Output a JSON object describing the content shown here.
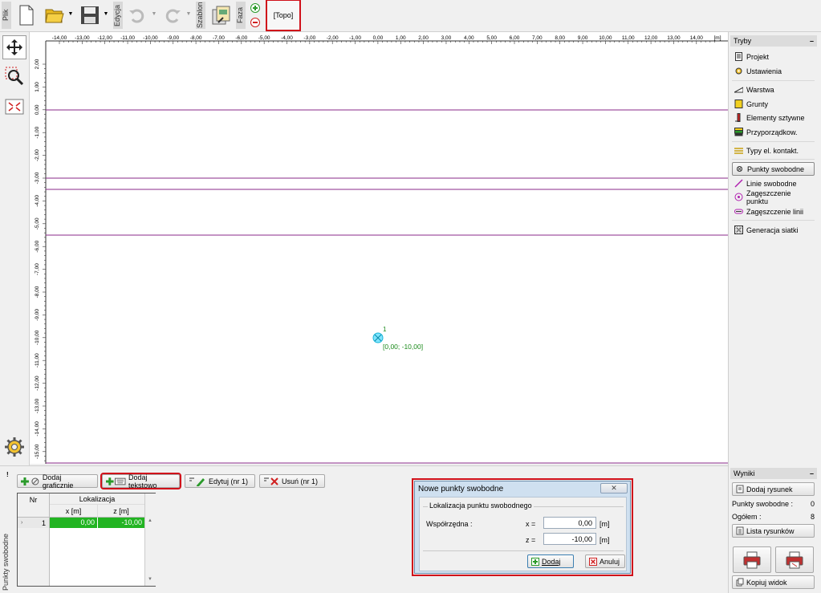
{
  "toolbar": {
    "plik": "Plik",
    "edycja": "Edycja",
    "szablon": "Szablon",
    "faza": "Faza",
    "stage": "[Topo]"
  },
  "ruler_x": {
    "ticks": [
      "-14,00",
      "-13,00",
      "-12,00",
      "-11,00",
      "-10,00",
      "-9,00",
      "-8,00",
      "-7,00",
      "-6,00",
      "-5,00",
      "-4,00",
      "-3,00",
      "-2,00",
      "-1,00",
      "0,00",
      "1,00",
      "2,00",
      "3,00",
      "4,00",
      "5,00",
      "6,00",
      "7,00",
      "8,00",
      "9,00",
      "10,00",
      "11,00",
      "12,00",
      "13,00",
      "14,00"
    ],
    "unit": "[m]"
  },
  "ruler_y": {
    "ticks": [
      "2,00",
      "1,00",
      "0,00",
      "-1,00",
      "-2,00",
      "-3,00",
      "-4,00",
      "-5,00",
      "-6,00",
      "-7,00",
      "-8,00",
      "-9,00",
      "-10,00",
      "-11,00",
      "-12,00",
      "-13,00",
      "-14,00",
      "-15,00"
    ]
  },
  "canvas": {
    "point_number": "1",
    "point_label": "[0,00; -10,00]"
  },
  "right_panel": {
    "tryby_title": "Tryby",
    "items": [
      {
        "label": "Projekt",
        "icon": "document-icon"
      },
      {
        "label": "Ustawienia",
        "icon": "gear-icon"
      },
      {
        "label": "Warstwa",
        "icon": "layer-icon"
      },
      {
        "label": "Grunty",
        "icon": "soil-icon"
      },
      {
        "label": "Elementy sztywne",
        "icon": "rigid-element-icon"
      },
      {
        "label": "Przyporządkow.",
        "icon": "assignment-icon"
      },
      {
        "label": "Typy el. kontakt.",
        "icon": "contact-icon"
      },
      {
        "label": "Punkty swobodne",
        "icon": "free-point-icon"
      },
      {
        "label": "Linie swobodne",
        "icon": "free-line-icon"
      },
      {
        "label": "Zagęszczenie punktu",
        "icon": "point-refinement-icon"
      },
      {
        "label": "Zagęszczenie linii",
        "icon": "line-refinement-icon"
      },
      {
        "label": "Generacja siatki",
        "icon": "mesh-icon"
      }
    ],
    "wyniki_title": "Wyniki",
    "add_drawing": "Dodaj rysunek",
    "free_points_label": "Punkty swobodne :",
    "free_points_value": "0",
    "total_label": "Ogółem :",
    "total_value": "8",
    "drawing_list": "Lista rysunków",
    "copy_view": "Kopiuj widok"
  },
  "bottom": {
    "side_label": "Punkty swobodne",
    "buttons": {
      "add_graphic": "Dodaj graficznie",
      "add_text": "Dodaj tekstowo",
      "edit": "Edytuj (nr 1)",
      "delete": "Usuń (nr 1)"
    },
    "table": {
      "col_nr": "Nr",
      "col_loc": "Lokalizacja",
      "col_x": "x [m]",
      "col_z": "z [m]",
      "rows": [
        {
          "nr": "1",
          "x": "0,00",
          "z": "-10,00"
        }
      ]
    }
  },
  "dialog": {
    "title": "Nowe punkty swobodne",
    "group": "Lokalizacja punktu swobodnego",
    "coord_label": "Współrzędna :",
    "x_label": "x =",
    "x_value": "0,00",
    "x_unit": "[m]",
    "z_label": "z =",
    "z_value": "-10,00",
    "z_unit": "[m]",
    "add": "Dodaj",
    "cancel": "Anuluj"
  }
}
